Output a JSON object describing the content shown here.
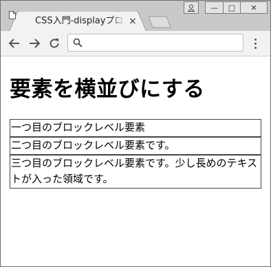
{
  "tab": {
    "title": "CSS入門-displayプロパティ",
    "close": "×"
  },
  "window_controls": {
    "minimize": "—",
    "maximize": "□",
    "close": "✕"
  },
  "omnibox": {
    "value": "",
    "placeholder": ""
  },
  "page": {
    "heading": "要素を横並びにする",
    "blocks": [
      "一つ目のブロックレベル要素",
      "二つ目のブロックレベル要素です。",
      "三つ目のブロックレベル要素です。少し長めのテキストが入った領域です。"
    ]
  },
  "icons": {
    "tab": "page-icon",
    "back": "back-arrow-icon",
    "forward": "forward-arrow-icon",
    "reload": "reload-icon",
    "search": "search-icon",
    "menu": "menu-dots-icon",
    "user": "user-icon"
  }
}
